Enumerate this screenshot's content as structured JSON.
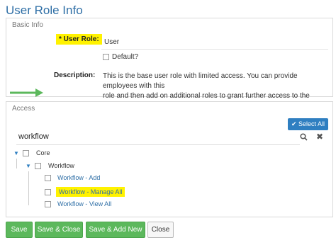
{
  "header": {
    "title": "User Role Info"
  },
  "basic_info": {
    "section_label": "Basic Info",
    "role_label": "* User Role:",
    "role_value": "User",
    "default_label": "Default?",
    "description_label": "Description:",
    "description_line1": "This is the base user role with limited access.  You can provide employees with this",
    "description_line2": "role and then add on additional roles to grant further access to the system."
  },
  "access": {
    "section_label": "Access",
    "select_all_label": "✔ Select All",
    "search_value": "workflow",
    "tree": {
      "root": "Core",
      "group": "Workflow",
      "items": [
        "Workflow - Add",
        "Workflow - Manage All",
        "Workflow - View All"
      ]
    }
  },
  "buttons": {
    "save": "Save",
    "save_close": "Save & Close",
    "save_add_new": "Save & Add New",
    "close": "Close"
  },
  "colors": {
    "highlight": "#fff200",
    "primary_button": "#5cb85c",
    "link": "#2f6fa6",
    "arrow": "#5cb85c"
  }
}
